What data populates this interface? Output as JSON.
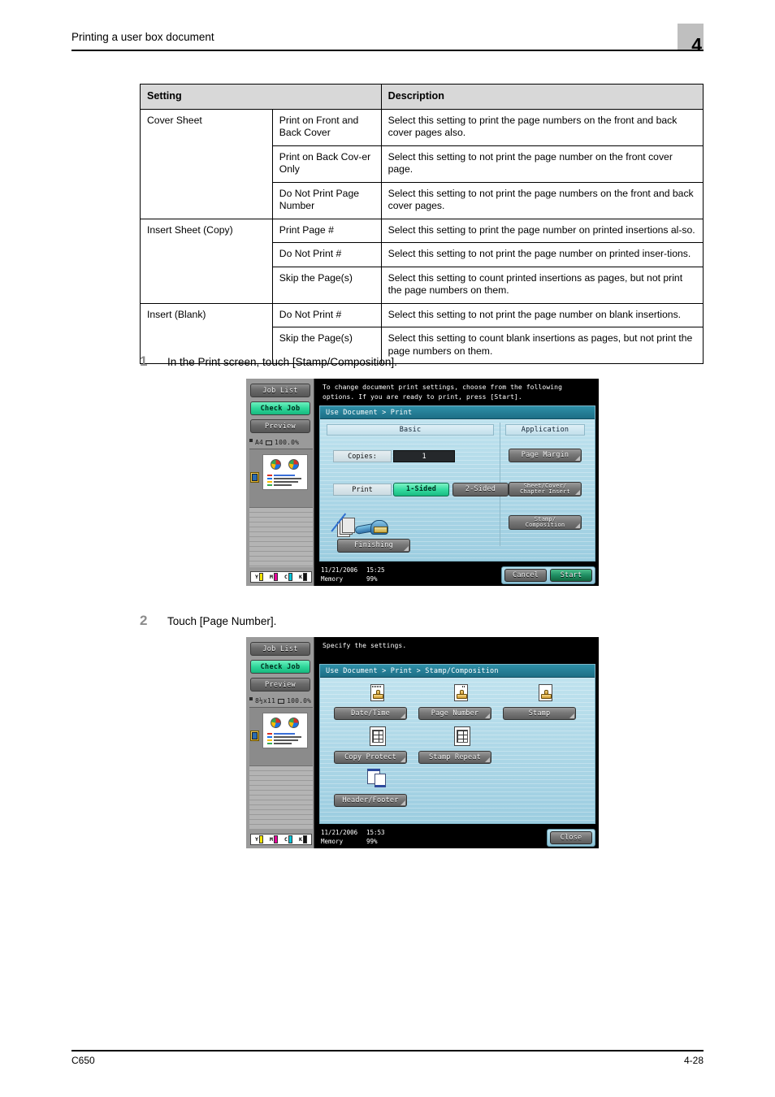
{
  "header": {
    "title": "Printing a user box document",
    "chapter": "4"
  },
  "table": {
    "columns": [
      "Setting",
      "Description"
    ],
    "groups": [
      {
        "name": "Cover Sheet",
        "rows": [
          {
            "option": "Print on Front and Back Cover",
            "description": "Select this setting to print the page numbers on the front and back cover pages also."
          },
          {
            "option": "Print on Back Cov-er Only",
            "description": "Select this setting to not print the page number on the front cover page."
          },
          {
            "option": "Do Not Print Page Number",
            "description": "Select this setting to not print the page numbers on the front and back cover pages."
          }
        ]
      },
      {
        "name": "Insert Sheet (Copy)",
        "rows": [
          {
            "option": "Print Page #",
            "description": "Select this setting to print the page number on printed insertions al-so."
          },
          {
            "option": "Do Not Print #",
            "description": "Select this setting to not print the page number on printed inser-tions."
          },
          {
            "option": "Skip the Page(s)",
            "description": "Select this setting to count printed insertions as pages, but not print the page numbers on them."
          }
        ]
      },
      {
        "name": "Insert (Blank)",
        "rows": [
          {
            "option": "Do Not Print #",
            "description": "Select this setting to not print the page number on blank insertions."
          },
          {
            "option": "Skip the Page(s)",
            "description": "Select this setting to count blank insertions as pages, but not print the page numbers on them."
          }
        ]
      }
    ]
  },
  "steps": [
    {
      "number": "1",
      "text": "In the Print screen, touch [Stamp/Composition]."
    },
    {
      "number": "2",
      "text": "Touch [Page Number]."
    }
  ],
  "panel1": {
    "side_buttons": [
      {
        "label": "Job List",
        "state": "normal"
      },
      {
        "label": "Check Job",
        "state": "active"
      },
      {
        "label": "Preview",
        "state": "normal"
      }
    ],
    "paper_info": "A4",
    "zoom": "100.0%",
    "message": "To change document print settings, choose from the following\noptions. If you are ready to print, press [Start].",
    "breadcrumb": "Use Document > Print",
    "tabs": {
      "basic": "Basic",
      "application": "Application"
    },
    "copies_label": "Copies:",
    "copies_value": "1",
    "print_label": "Print",
    "sided_1": "1-Sided",
    "sided_2": "2-Sided",
    "finishing": "Finishing",
    "app_buttons": [
      "Page Margin",
      "Sheet/Cover/\nChapter Insert",
      "Stamp/\nComposition"
    ],
    "date": "11/21/2006",
    "time": "15:25",
    "memory_label": "Memory",
    "memory_value": "99%",
    "cancel": "Cancel",
    "start": "Start",
    "toner": [
      {
        "label": "Y",
        "color": "#f5e400"
      },
      {
        "label": "M",
        "color": "#e8009a"
      },
      {
        "label": "C",
        "color": "#00c3d8"
      },
      {
        "label": "K",
        "color": "#111111"
      }
    ]
  },
  "panel2": {
    "side_buttons": [
      {
        "label": "Job List",
        "state": "normal"
      },
      {
        "label": "Check Job",
        "state": "active"
      },
      {
        "label": "Preview",
        "state": "normal"
      }
    ],
    "paper_info": "8½x11",
    "zoom": "100.0%",
    "message": "Specify the settings.",
    "breadcrumb": "Use Document > Print > Stamp/Composition",
    "buttons": [
      {
        "label": "Date/Time",
        "icon": "stamp-icon"
      },
      {
        "label": "Page Number",
        "icon": "stamp-icon"
      },
      {
        "label": "Stamp",
        "icon": "stamp-icon"
      },
      {
        "label": "Copy Protect",
        "icon": "grid-icon"
      },
      {
        "label": "Stamp Repeat",
        "icon": "grid-icon"
      },
      {
        "label": "Header/Footer",
        "icon": "pages-icon"
      }
    ],
    "date": "11/21/2006",
    "time": "15:53",
    "memory_label": "Memory",
    "memory_value": "99%",
    "close": "Close",
    "toner": [
      {
        "label": "Y",
        "color": "#f5e400"
      },
      {
        "label": "M",
        "color": "#e8009a"
      },
      {
        "label": "C",
        "color": "#00c3d8"
      },
      {
        "label": "K",
        "color": "#111111"
      }
    ]
  },
  "footer": {
    "model": "C650",
    "page": "4-28"
  }
}
